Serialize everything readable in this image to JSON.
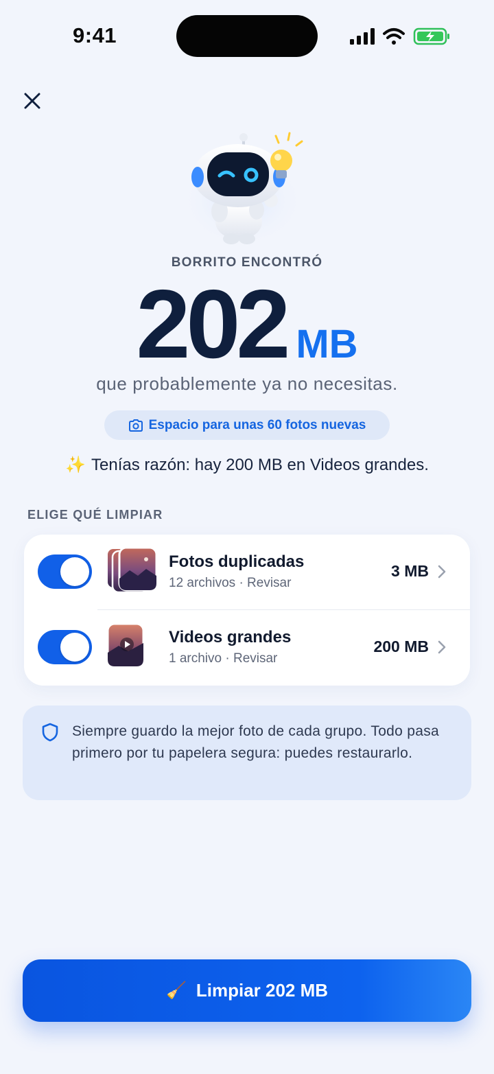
{
  "status_bar": {
    "time": "9:41"
  },
  "icons": {
    "close": "close-icon",
    "camera": "camera-icon",
    "sparkles": "sparkles-icon",
    "shield": "shield-icon",
    "chevron": "chevron-right-icon",
    "broom": "broom-icon"
  },
  "header": {
    "eyebrow": "BORRITO ENCONTRÓ",
    "amount": "202",
    "unit": "MB",
    "subtitle": "que probablemente ya no necesitas.",
    "pill": "Espacio para unas 60 fotos nuevas",
    "insight_emoji": "✨",
    "insight": "Tenías razón: hay 200 MB en Videos grandes."
  },
  "section_label": "ELIGE QUÉ LIMPIAR",
  "items": [
    {
      "title": "Fotos duplicadas",
      "subtitle": "12 archivos · Revisar",
      "size": "3 MB",
      "enabled": true
    },
    {
      "title": "Videos grandes",
      "subtitle": "1 archivo · Revisar",
      "size": "200 MB",
      "enabled": true
    }
  ],
  "info": {
    "text": "Siempre guardo la mejor foto de cada grupo. Todo pasa primero por tu papelera segura: puedes restaurarlo."
  },
  "cta": {
    "emoji": "🧹",
    "label": "Limpiar 202 MB"
  },
  "colors": {
    "accent": "#1570ef",
    "background": "#f2f5fc",
    "toggle_on": "#1160e8",
    "info_bg": "#e0e9fa"
  }
}
